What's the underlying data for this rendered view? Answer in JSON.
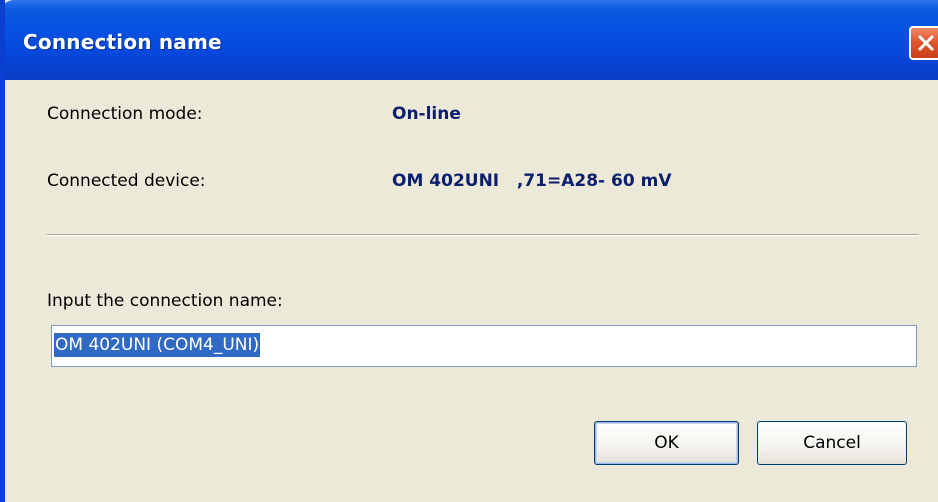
{
  "window": {
    "title": "Connection name"
  },
  "info": {
    "mode_label": "Connection mode:",
    "mode_value": "On-line",
    "device_label": "Connected device:",
    "device_value": "OM 402UNI   ,71=A28- 60 mV"
  },
  "form": {
    "name_label": "Input the connection name:",
    "name_value": "OM 402UNI (COM4_UNI)"
  },
  "buttons": {
    "ok_label": "OK",
    "cancel_label": "Cancel"
  },
  "icons": {
    "close": "close-icon"
  },
  "colors": {
    "titlebar": "#0651e2",
    "close_button": "#e2562e",
    "value_text": "#0b1f6e",
    "selection": "#316ac5",
    "dialog_bg": "#ece9d8"
  }
}
